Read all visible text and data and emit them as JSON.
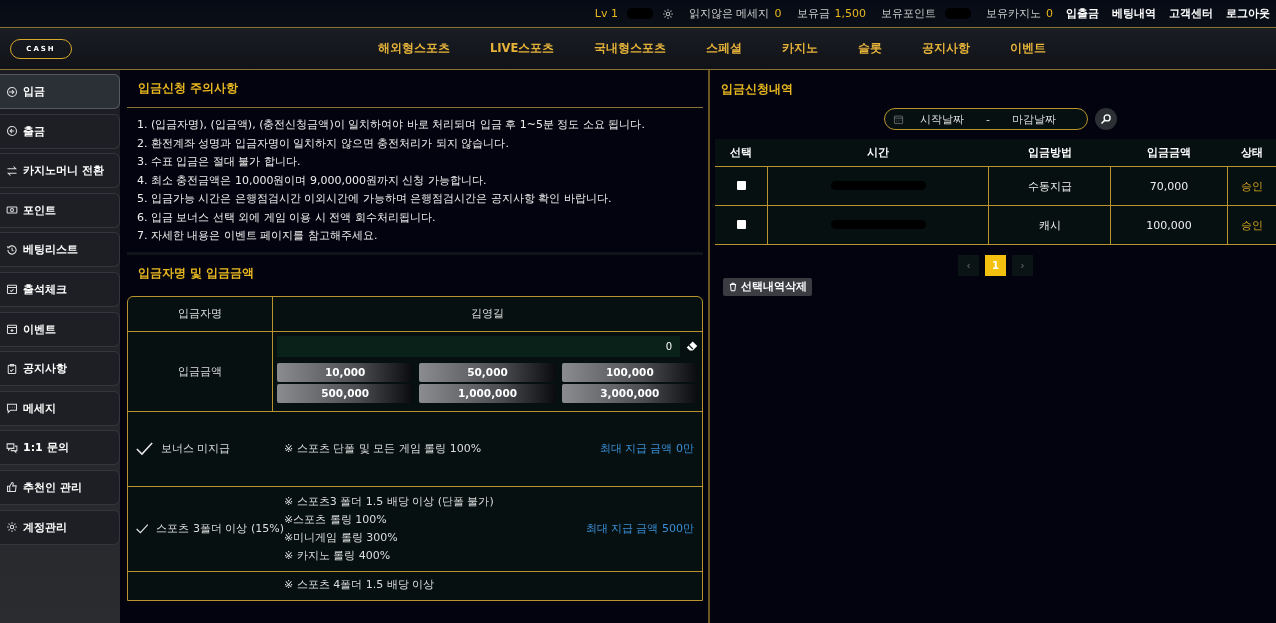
{
  "top_bar": {
    "level": "Lv 1",
    "username_redacted": true,
    "stats": [
      {
        "label": "읽지않은 메세지",
        "value": "0"
      },
      {
        "label": "보유금",
        "value": "1,500"
      },
      {
        "label": "보유포인트",
        "redacted": true
      },
      {
        "label": "보유카지노",
        "value": "0"
      }
    ],
    "links": [
      "입출금",
      "베팅내역",
      "고객센터"
    ],
    "logout": "로그아웃"
  },
  "nav": {
    "logo": "CASH",
    "items": [
      "해외형스포츠",
      "LIVE스포츠",
      "국내형스포츠",
      "스페셜",
      "카지노",
      "슬롯",
      "공지사항",
      "이벤트"
    ]
  },
  "sidebar": {
    "items": [
      {
        "label": "입금",
        "selected": true
      },
      {
        "label": "출금",
        "selected": false
      },
      {
        "label": "카지노머니 전환",
        "selected": false
      },
      {
        "label": "포인트",
        "selected": false
      },
      {
        "label": "베팅리스트",
        "selected": false
      },
      {
        "label": "출석체크",
        "selected": false
      },
      {
        "label": "이벤트",
        "selected": false
      },
      {
        "label": "공지사항",
        "selected": false
      },
      {
        "label": "메세지",
        "selected": false
      },
      {
        "label": "1:1 문의",
        "selected": false
      },
      {
        "label": "추천인 관리",
        "selected": false
      },
      {
        "label": "계정관리",
        "selected": false
      }
    ]
  },
  "notice": {
    "title": "입금신청 주의사항",
    "lines": [
      "1. (입금자명), (입금액), (충전신청금액)이 일치하여야 바로 처리되며 입금 후 1~5분 정도 소요 됩니다.",
      "2. 환전계좌 성명과 입금자명이 일치하지 않으면 충전처리가 되지 않습니다.",
      "3. 수표 입금은 절대 불가 합니다.",
      "4. 최소 충전금액은 10,000원이며 9,000,000원까지 신청 가능합니다.",
      "5. 입금가능 시간은 은행점검시간 이외시간에 가능하며 은행점검시간은 공지사항 확인 바랍니다.",
      "6. 입금 보너스 선택 외에 게임 이용 시 전액 회수처리됩니다.",
      "7. 자세한 내용은 이벤트 페이지를 참고해주세요."
    ]
  },
  "deposit_form": {
    "title": "입금자명 및 입금금액",
    "name_label": "입금자명",
    "name_value": "김영길",
    "amount_label": "입금금액",
    "amount_value": "0",
    "quick_amounts": [
      "10,000",
      "50,000",
      "100,000",
      "500,000",
      "1,000,000",
      "3,000,000"
    ],
    "bonus_options": [
      {
        "label": "보너스 미지급",
        "checked": true,
        "conditions": [
          "※ 스포츠 단폴 및 모든 게임 롤링 100%"
        ],
        "max_payout": "최대 지급 금액 0만"
      },
      {
        "label": "스포츠 3폴더 이상 (15%)",
        "checked": true,
        "conditions": [
          "※ 스포츠3 폴더 1.5 배당 이상 (단폴 불가)",
          "※스포츠 롤링 100%",
          "※미니게임 롤링 300%",
          "※ 카지노 롤링 400%"
        ],
        "max_payout": "최대 지급 금액 500만"
      },
      {
        "checked": false,
        "conditions": [
          "※ 스포츠 4폴더 1.5 배당 이상"
        ]
      }
    ]
  },
  "history": {
    "title": "입금신청내역",
    "start_placeholder": "시작날짜",
    "separator": "-",
    "end_placeholder": "마감날짜",
    "columns": [
      "선택",
      "시간",
      "입금방법",
      "입금금액",
      "상태"
    ],
    "rows": [
      {
        "selected": false,
        "time_redacted": true,
        "method": "수동지급",
        "amount": "70,000",
        "status": "승인"
      },
      {
        "selected": false,
        "time_redacted": true,
        "method": "캐시",
        "amount": "100,000",
        "status": "승인"
      }
    ],
    "pagination": {
      "prev": "‹",
      "pages": [
        {
          "label": "1",
          "selected": true
        }
      ],
      "next": "›"
    },
    "delete_button": "선택내역삭제"
  }
}
